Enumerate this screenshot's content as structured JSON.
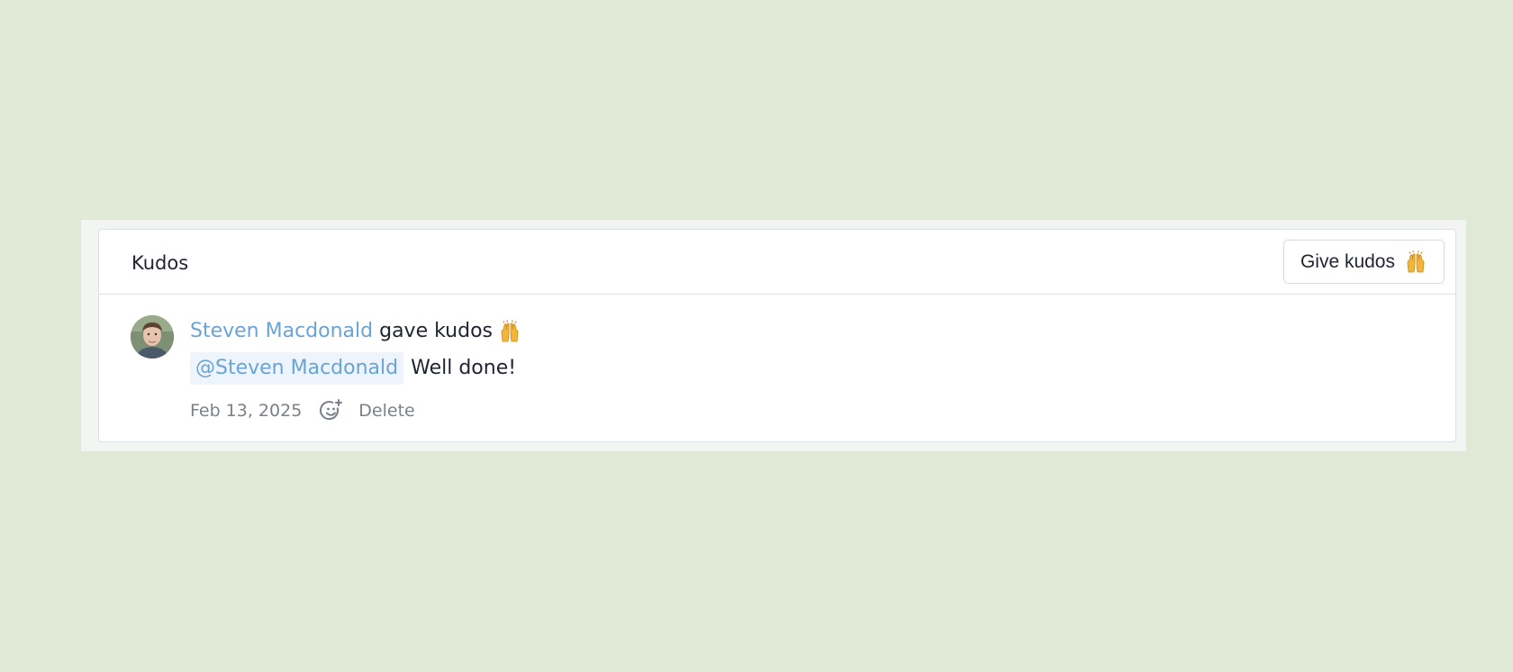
{
  "panel": {
    "title": "Kudos",
    "give_button_label": "Give kudos"
  },
  "entry": {
    "author": "Steven Macdonald",
    "action": "gave kudos",
    "mention": "@Steven Macdonald",
    "message": "Well done!",
    "date": "Feb 13, 2025",
    "delete_label": "Delete"
  },
  "icons": {
    "give_button_icon": "raising-hands-icon",
    "entry_icon": "raising-hands-icon",
    "reaction_icon": "add-reaction-icon"
  },
  "colors": {
    "background": "#dfe9d6",
    "link": "#6aa3d6",
    "mention_bg": "#edf4fb",
    "muted_text": "#7b818a"
  }
}
